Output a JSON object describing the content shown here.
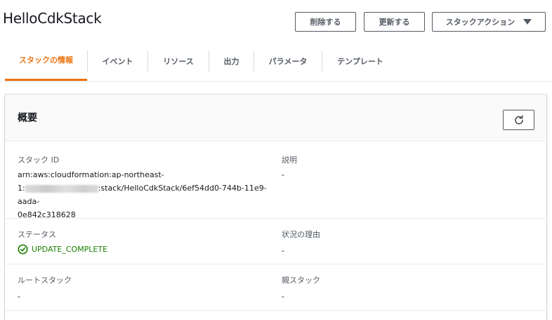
{
  "header": {
    "title": "HelloCdkStack",
    "delete_label": "削除する",
    "update_label": "更新する",
    "actions_label": "スタックアクション"
  },
  "tabs": [
    {
      "label": "スタックの情報",
      "active": true
    },
    {
      "label": "イベント"
    },
    {
      "label": "リソース"
    },
    {
      "label": "出力"
    },
    {
      "label": "パラメータ"
    },
    {
      "label": "テンプレート"
    }
  ],
  "overview": {
    "title": "概要",
    "stack_id_label": "スタック ID",
    "stack_id_line1": "arn:aws:cloudformation:ap-northeast-",
    "stack_id_line2_prefix": "1:",
    "stack_id_line2_suffix": ":stack/HelloCdkStack/6ef54dd0-744b-11e9-aada-",
    "stack_id_line3": "0e842c318628",
    "description_label": "説明",
    "description_value": "-",
    "status_label": "ステータス",
    "status_value": "UPDATE_COMPLETE",
    "status_reason_label": "状況の理由",
    "status_reason_value": "-",
    "root_stack_label": "ルートスタック",
    "root_stack_value": "-",
    "parent_stack_label": "親スタック",
    "parent_stack_value": "-"
  },
  "colors": {
    "accent": "#ec7211",
    "success": "#1d8102",
    "button_border": "#545b64"
  },
  "icons": {
    "refresh": "refresh-icon",
    "status": "check-circle-icon",
    "dropdown": "caret-down-icon"
  }
}
